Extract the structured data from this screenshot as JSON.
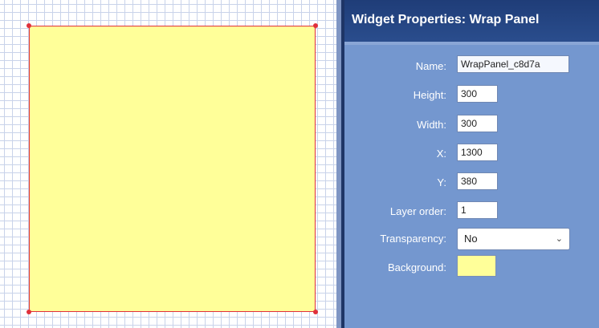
{
  "canvas": {
    "panel_fill": "#ffff99",
    "panel_border": "#e0313b"
  },
  "properties": {
    "title": "Widget Properties: Wrap Panel",
    "name_label": "Name:",
    "name_value": "WrapPanel_c8d7a",
    "height_label": "Height:",
    "height_value": "300",
    "width_label": "Width:",
    "width_value": "300",
    "x_label": "X:",
    "x_value": "1300",
    "y_label": "Y:",
    "y_value": "380",
    "layer_label": "Layer order:",
    "layer_value": "1",
    "transparency_label": "Transparency:",
    "transparency_value": "No",
    "background_label": "Background:",
    "background_color": "#ffff99"
  }
}
